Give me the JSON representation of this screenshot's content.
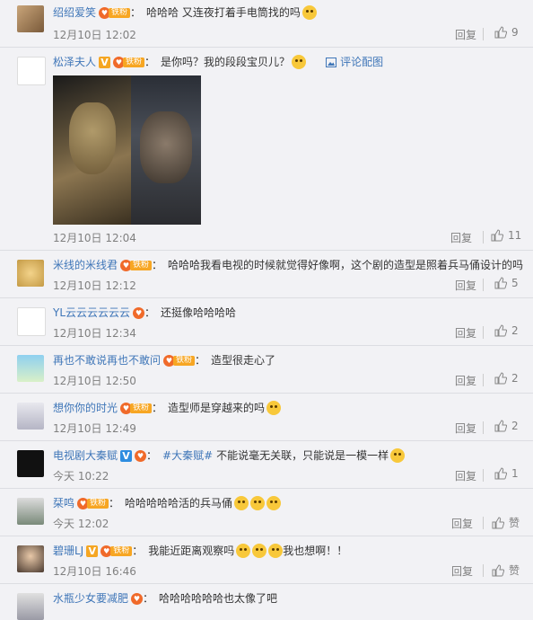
{
  "like_icon": "thumbs-up-icon",
  "comments": [
    {
      "user": "绍绍爱笑",
      "badge": "fan",
      "fan_label": "铁粉",
      "text": "哈哈哈 又连夜打着手电筒找的吗",
      "emoji": "doge",
      "time": "12月10日 12:02",
      "reply": "回复",
      "likes": "9"
    },
    {
      "user": "松泽夫人",
      "badge": "v-fan",
      "fan_label": "铁粉",
      "text": "是你吗？我的段段宝贝儿？",
      "emoji": "doge",
      "pic_link": "评论配图",
      "time": "12月10日 12:04",
      "reply": "回复",
      "likes": "11"
    },
    {
      "user": "米线的米线君",
      "badge": "fan",
      "fan_label": "铁粉",
      "text": "哈哈哈我看电视的时候就觉得好像啊，这个剧的造型是照着兵马俑设计的吗",
      "time": "12月10日 12:12",
      "reply": "回复",
      "likes": "5"
    },
    {
      "user": "YL云云云云云云",
      "badge": "fan-heart",
      "text": "还挺像哈哈哈哈",
      "time": "12月10日 12:34",
      "reply": "回复",
      "likes": "2"
    },
    {
      "user": "再也不敢说再也不敢问",
      "badge": "fan",
      "fan_label": "铁粉",
      "text": "造型很走心了",
      "time": "12月10日 12:50",
      "reply": "回复",
      "likes": "2"
    },
    {
      "user": "想你你的时光",
      "badge": "fan",
      "fan_label": "铁粉",
      "text": "造型师是穿越来的吗",
      "emoji": "laugh",
      "time": "12月10日 12:49",
      "reply": "回复",
      "likes": "2"
    },
    {
      "user": "电视剧大秦赋",
      "badge": "bluev-heart",
      "hashtag": "#大秦赋#",
      "text": "不能说毫无关联，只能说是一模一样",
      "emoji": "doge",
      "time": "今天 10:22",
      "reply": "回复",
      "likes": "1"
    },
    {
      "user": "栞鸣",
      "badge": "fan",
      "fan_label": "铁粉",
      "text": "哈哈哈哈哈活的兵马俑",
      "emoji_count": 3,
      "time": "今天 12:02",
      "reply": "回复",
      "likes": "赞"
    },
    {
      "user": "碧珊LJ",
      "badge": "v-fan",
      "fan_label": "铁粉",
      "text": "我能近距离观察吗",
      "text2": "我也想啊！！",
      "emoji_count": 3,
      "time": "12月10日 16:46",
      "reply": "回复",
      "likes": "赞"
    },
    {
      "user": "水瓶少女要减肥",
      "badge": "fan-heart",
      "text": "哈哈哈哈哈哈也太像了吧"
    }
  ]
}
